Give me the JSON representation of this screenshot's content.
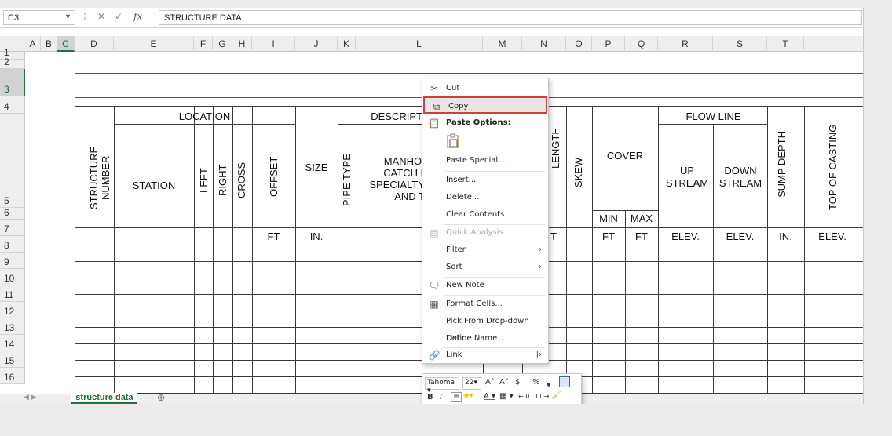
{
  "formula_bar": {
    "name_box": "C3",
    "fx": "fx",
    "content": "STRUCTURE DATA"
  },
  "columns": [
    "A",
    "B",
    "C",
    "D",
    "E",
    "F",
    "G",
    "H",
    "I",
    "J",
    "K",
    "L",
    "M",
    "N",
    "O",
    "P",
    "Q",
    "R",
    "S",
    "T"
  ],
  "rows": [
    "1",
    "2",
    "3",
    "4",
    "5",
    "6",
    "7",
    "8",
    "9",
    "10",
    "11",
    "12",
    "13",
    "14",
    "15",
    "16"
  ],
  "sheet": {
    "location": "LOCATION",
    "description": "DESCRIPT",
    "flow_line": "FLOW LINE",
    "structure_number": "STRUCTURE NUMBER",
    "station": "STATION",
    "left": "LEFT",
    "right": "RIGHT",
    "cross": "CROSS",
    "offset": "OFFSET",
    "size": "SIZE",
    "pipe_type": "PIPE TYPE",
    "manhole_lines": [
      "MANHOLE",
      "CATCH BA",
      "SPECIALTY S",
      "AND T"
    ],
    "length": "LENGTH",
    "skew": "SKEW",
    "cover": "COVER",
    "min": "MIN",
    "max": "MAX",
    "up_stream": "UP STREAM",
    "down_stream": "DOWN STREAM",
    "sump_depth": "SUMP DEPTH",
    "top_of_casting": "TOP OF CASTING",
    "units": {
      "offset": "FT",
      "size": "IN.",
      "length": "T",
      "min": "FT",
      "max": "FT",
      "up": "ELEV.",
      "down": "ELEV.",
      "sump": "IN.",
      "top": "ELEV."
    }
  },
  "tabs": {
    "active": "structure data",
    "add": "⊕"
  },
  "context_menu": {
    "cut": "Cut",
    "copy": "Copy",
    "paste_options": "Paste Options:",
    "paste_special": "Paste Special...",
    "insert": "Insert...",
    "delete": "Delete...",
    "clear_contents": "Clear Contents",
    "quick_analysis": "Quick Analysis",
    "filter": "Filter",
    "sort": "Sort",
    "new_note": "New Note",
    "format_cells": "Format Cells...",
    "pick_list": "Pick From Drop-down List...",
    "define_name": "Define Name...",
    "link": "Link"
  },
  "mini_toolbar": {
    "font": "Tahoma",
    "size": "22",
    "grow": "A˄",
    "shrink": "A˅",
    "currency": "$",
    "percent": "%",
    "comma": "❟",
    "bold": "B",
    "italic": "I"
  },
  "colors": {
    "excel_green": "#217346",
    "highlight_red": "#d93b3b"
  }
}
